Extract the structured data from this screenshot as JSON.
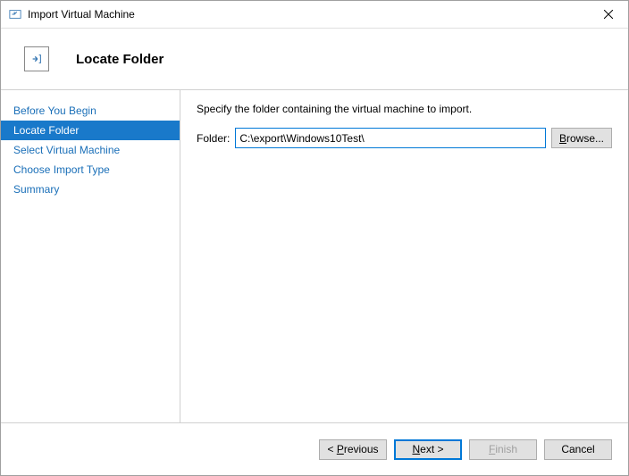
{
  "window": {
    "title": "Import Virtual Machine"
  },
  "header": {
    "title": "Locate Folder"
  },
  "sidebar": {
    "items": [
      {
        "label": "Before You Begin"
      },
      {
        "label": "Locate Folder"
      },
      {
        "label": "Select Virtual Machine"
      },
      {
        "label": "Choose Import Type"
      },
      {
        "label": "Summary"
      }
    ],
    "selected_index": 1
  },
  "content": {
    "instruction": "Specify the folder containing the virtual machine to import.",
    "folder_label": "Folder:",
    "folder_value": "C:\\export\\Windows10Test\\",
    "browse_prefix": "B",
    "browse_rest": "rowse..."
  },
  "footer": {
    "previous_prefix": "< ",
    "previous_u": "P",
    "previous_rest": "revious",
    "next_u": "N",
    "next_rest": "ext >",
    "finish_u": "F",
    "finish_rest": "inish",
    "cancel": "Cancel"
  }
}
